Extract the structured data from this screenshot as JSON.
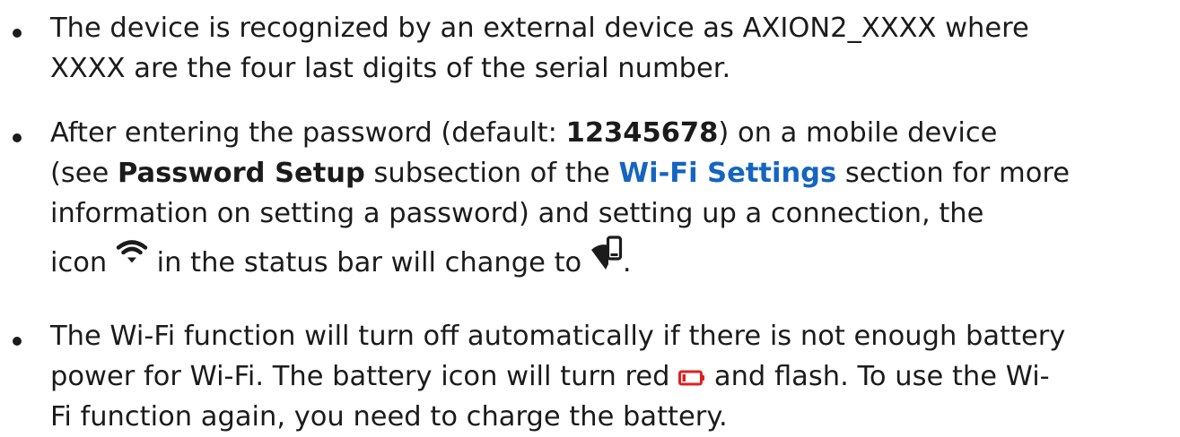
{
  "items": [
    {
      "lines": [
        "The device is recognized by an external device as AXION2_XXXX where",
        "XXXX are the four last digits of the serial number."
      ]
    },
    {
      "l1_a": "After entering the password (default: ",
      "l1_bold": "12345678",
      "l1_b": ") on a mobile device",
      "l2_a": "(see ",
      "l2_bold": "Password Setup",
      "l2_b": " subsection of the ",
      "l2_link": "Wi-Fi Settings",
      "l2_c": " section for more",
      "l3": "information on setting a password) and setting up a connection, the",
      "l4_a": "icon ",
      "l4_b": " in the status bar will change to ",
      "l4_c": "."
    },
    {
      "lines": [
        "The Wi-Fi function will turn off automatically if there is not enough battery"
      ],
      "l2_a": "power for Wi-Fi. The battery icon will turn red ",
      "l2_b": " and flash. To use the Wi-",
      "l3": "Fi function again, you need to charge the battery."
    }
  ],
  "colors": {
    "text": "#1b1b1b",
    "link": "#1565c0",
    "battery_low": "#e02020"
  },
  "icons": {
    "wifi": "wifi-icon",
    "phone_connected": "wifi-phone-connected-icon",
    "battery": "battery-low-icon"
  }
}
